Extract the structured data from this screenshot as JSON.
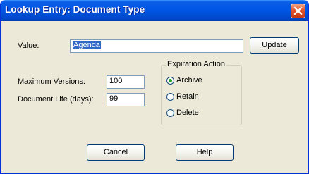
{
  "window": {
    "title": "Lookup Entry: Document Type"
  },
  "form": {
    "value_label": "Value:",
    "value": "Agenda",
    "max_versions_label": "Maximum Versions:",
    "max_versions": "100",
    "doc_life_label": "Document Life (days):",
    "doc_life": "99"
  },
  "expiration": {
    "legend": "Expiration Action",
    "options": [
      {
        "label": "Archive",
        "selected": true
      },
      {
        "label": "Retain",
        "selected": false
      },
      {
        "label": "Delete",
        "selected": false
      }
    ]
  },
  "buttons": {
    "update": "Update",
    "cancel": "Cancel",
    "help": "Help"
  },
  "colors": {
    "titlebar": "#0055e5",
    "dialog_bg": "#ece9d8",
    "selection": "#316ac5",
    "radio_dot": "#21a121",
    "close_button": "#e3532c"
  },
  "icons": {
    "close": "close-icon"
  }
}
